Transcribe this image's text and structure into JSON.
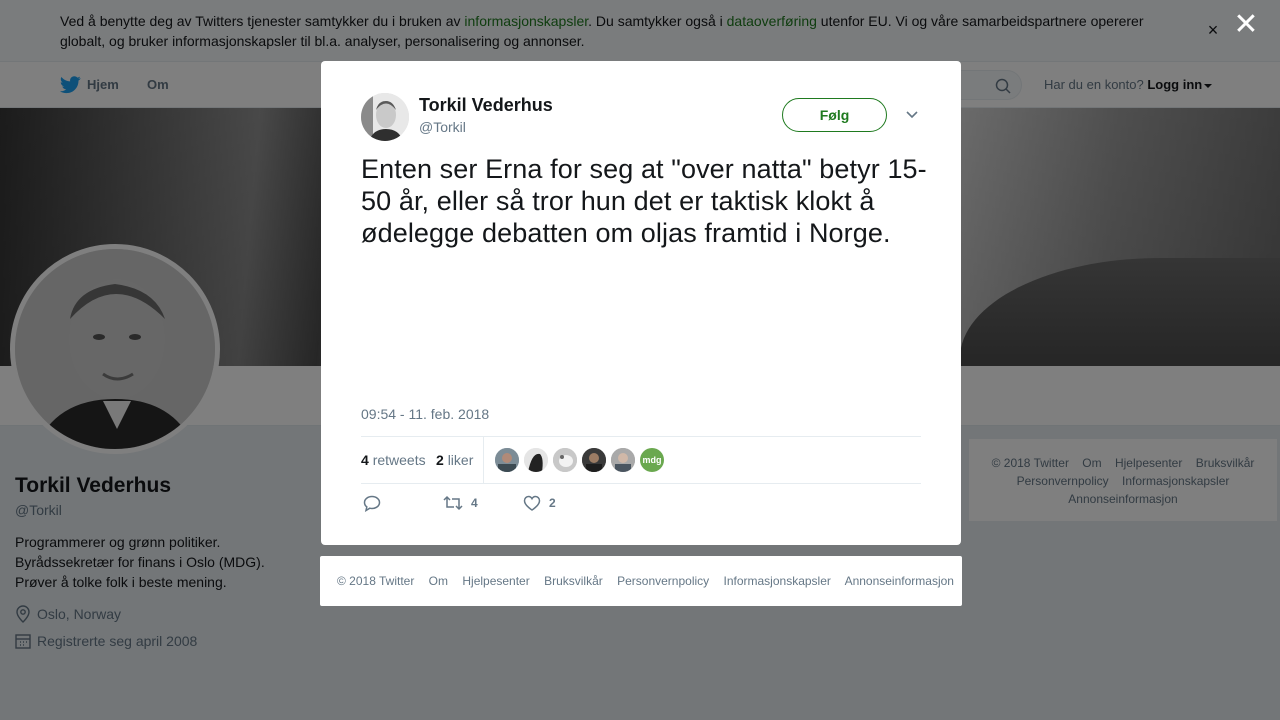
{
  "cookie_notice": {
    "text_1": "Ved å benytte deg av Twitters tjenester samtykker du i bruken av ",
    "link_1": "informasjonskapsler",
    "text_2": ". Du samtykker også i ",
    "link_2": "dataoverføring",
    "text_3": " utenfor EU. Vi og våre samarbeidspartnere opererer globalt, og bruker informasjonskapsler til bl.a. analyser, personalisering og annonser.",
    "close_glyph": "×"
  },
  "overlay": {
    "close_glyph": "✕"
  },
  "topnav": {
    "home_label": "Hjem",
    "about_label": "Om",
    "login_prompt": "Har du en konto?",
    "login_label": "Logg inn"
  },
  "profile": {
    "name": "Torkil Vederhus",
    "handle": "@Torkil",
    "bio": [
      "Programmerer og grønn politiker.",
      "Byrådssekretær for finans i Oslo (MDG).",
      "Prøver å tolke folk i beste mening."
    ],
    "location": "Oslo, Norway",
    "joined": "Registrerte seg april 2008"
  },
  "right_footer": {
    "items": [
      "© 2018 Twitter",
      "Om",
      "Hjelpesenter",
      "Bruksvilkår",
      "Personvernpolicy",
      "Informasjonskapsler",
      "Annonseinformasjon"
    ]
  },
  "tweet": {
    "author_name": "Torkil Vederhus",
    "author_handle": "@Torkil",
    "follow_label": "Følg",
    "text": "Enten ser Erna for seg at \"over natta\" betyr 15-50 år, eller så tror hun det er taktisk klokt å ødelegge debatten om oljas framtid i Norge.",
    "timestamp": "09:54 - 11. feb. 2018",
    "retweets_count": "4",
    "retweets_label": "retweets",
    "likes_count": "2",
    "likes_label": "liker",
    "liker_badge_text": "mdg",
    "action_retweet_count": "4",
    "action_like_count": "2"
  },
  "modal_footer": {
    "items": [
      "© 2018 Twitter",
      "Om",
      "Hjelpesenter",
      "Bruksvilkår",
      "Personvernpolicy",
      "Informasjonskapsler",
      "Annonseinformasjon"
    ]
  },
  "colors": {
    "link_green": "#1f7a1f",
    "twitter_blue": "#1da1f2",
    "text_gray": "#657786",
    "mdg_green": "#6aa84f"
  }
}
